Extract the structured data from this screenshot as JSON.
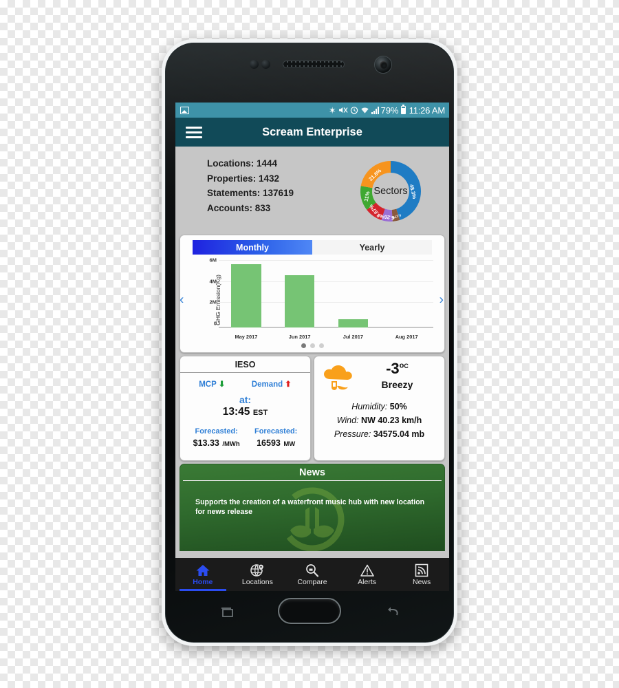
{
  "statusbar": {
    "image_icon": "image-icon",
    "bluetooth": "✶",
    "mute": "mute-icon",
    "alarm": "alarm-icon",
    "wifi": "wifi-icon",
    "signal": "signal-icon",
    "battery_percent": "79%",
    "time": "11:26 AM"
  },
  "appbar": {
    "menu_icon": "hamburger-menu-icon",
    "title": "Scream Enterprise"
  },
  "stats": {
    "items": [
      {
        "label": "Locations:",
        "value": "1444",
        "text": "Locations: 1444"
      },
      {
        "label": "Properties:",
        "value": "1432",
        "text": "Properties: 1432"
      },
      {
        "label": "Statements:",
        "value": "137619",
        "text": "Statements: 137619"
      },
      {
        "label": "Accounts:",
        "value": "833",
        "text": "Accounts: 833"
      }
    ]
  },
  "chart_data": [
    {
      "type": "pie",
      "title": "Sectors",
      "center_label": "Sectors",
      "donut": true,
      "labels": [
        "48.3%",
        "21.6%",
        "11%",
        "8.67%",
        "6.26%",
        "4.17%"
      ],
      "values": [
        48.3,
        21.6,
        11,
        8.67,
        6.26,
        4.17
      ],
      "colors": [
        "#1f7cc4",
        "#f7941e",
        "#3fa832",
        "#d4242d",
        "#9b6fd4",
        "#8a5a3c"
      ],
      "legend": "none"
    },
    {
      "type": "bar",
      "title": "",
      "categories": [
        "May 2017",
        "Jun 2017",
        "Jul 2017",
        "Aug 2017"
      ],
      "values": [
        6000000,
        4950000,
        800000,
        0
      ],
      "xlabel": "",
      "ylabel": "GHG Emission(Kg)",
      "ylim": [
        0,
        6400000
      ],
      "yticks": [
        "0",
        "2M",
        "4M",
        "6M"
      ],
      "ytick_values": [
        0,
        2000000,
        4000000,
        6000000
      ],
      "bar_color": "#76c474",
      "grid": true
    }
  ],
  "chart_card": {
    "tabs": [
      {
        "label": "Monthly",
        "active": true
      },
      {
        "label": "Yearly",
        "active": false
      }
    ],
    "prev_arrow": "‹",
    "next_arrow": "›",
    "dots": 3,
    "active_dot": 0
  },
  "ieso": {
    "title": "IESO",
    "mcp_label": "MCP",
    "mcp_trend": "down-arrow-icon",
    "demand_label": "Demand",
    "demand_trend": "up-arrow-icon",
    "at_label": "at:",
    "time_value": "13:45",
    "time_zone": "EST",
    "forecasts": [
      {
        "label": "Forecasted:",
        "value": "$13.33",
        "unit": "/MWh"
      },
      {
        "label": "Forecasted:",
        "value": "16593",
        "unit": "MW"
      }
    ]
  },
  "weather": {
    "icon": "windy-cloud-icon",
    "temperature": "-3",
    "degree": "o",
    "unit": "C",
    "condition": "Breezy",
    "rows": [
      {
        "label": "Humidity:",
        "value": "50%"
      },
      {
        "label": "Wind:",
        "value": "NW 40.23 km/h"
      },
      {
        "label": "Pressure:",
        "value": "34575.04 mb"
      }
    ]
  },
  "news": {
    "title": "News",
    "body": "Supports the creation of a waterfront music hub with new location for news release",
    "watermark": "leaf-tower-logo"
  },
  "bottomnav": {
    "items": [
      {
        "label": "Home",
        "icon": "home-icon",
        "active": true
      },
      {
        "label": "Locations",
        "icon": "globe-pin-icon",
        "active": false
      },
      {
        "label": "Compare",
        "icon": "magnifier-icon",
        "active": false
      },
      {
        "label": "Alerts",
        "icon": "warning-triangle-icon",
        "active": false
      },
      {
        "label": "News",
        "icon": "rss-icon",
        "active": false
      }
    ]
  },
  "hardware": {
    "recent_apps": "recent-apps-icon",
    "home_button": "home-button",
    "back": "back-arrow-icon"
  },
  "colors": {
    "statusbar": "#3e92a8",
    "appbar": "#114a58",
    "accent_blue": "#2b4cf0",
    "bar_green": "#76c474",
    "news_green": "#2f6a2d"
  }
}
